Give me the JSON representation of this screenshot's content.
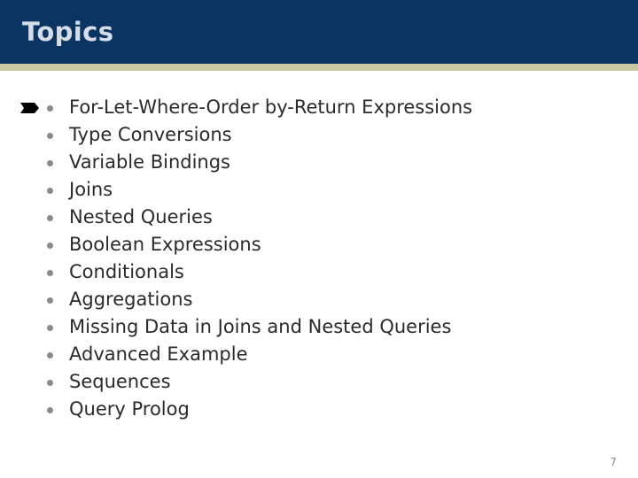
{
  "header": {
    "title": "Topics",
    "band_color": "#0a3563",
    "title_color": "#d7dde6",
    "accent_stripe_color": "#c8c9a0"
  },
  "body": {
    "background_color": "#ffffff",
    "text_color": "#2a2a2a",
    "bullet_color": "#8a8a8a",
    "marker_icon": "pennant-arrow-icon",
    "marker_color": "#000000",
    "items": [
      {
        "label": "For-Let-Where-Order by-Return Expressions",
        "marked": true
      },
      {
        "label": "Type Conversions",
        "marked": false
      },
      {
        "label": "Variable Bindings",
        "marked": false
      },
      {
        "label": "Joins",
        "marked": false
      },
      {
        "label": "Nested Queries",
        "marked": false
      },
      {
        "label": "Boolean Expressions",
        "marked": false
      },
      {
        "label": "Conditionals",
        "marked": false
      },
      {
        "label": "Aggregations",
        "marked": false
      },
      {
        "label": "Missing Data in Joins and Nested Queries",
        "marked": false
      },
      {
        "label": "Advanced Example",
        "marked": false
      },
      {
        "label": "Sequences",
        "marked": false
      },
      {
        "label": "Query Prolog",
        "marked": false
      }
    ]
  },
  "footer": {
    "page_number": "7",
    "page_number_color": "#8f8f8f"
  }
}
